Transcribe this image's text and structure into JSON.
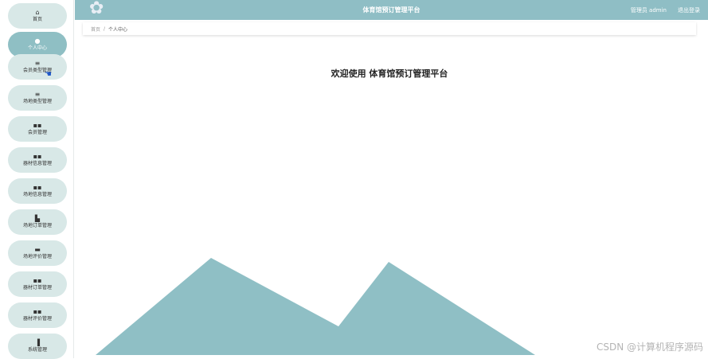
{
  "app": {
    "title": "体育馆预订管理平台"
  },
  "header": {
    "user": "管理员 admin",
    "logout": "退出登录"
  },
  "breadcrumb": {
    "home": "首页",
    "separator": "/",
    "current": "个人中心"
  },
  "welcome": "欢迎使用 体育馆预订管理平台",
  "sidebar": {
    "items": [
      {
        "icon": "⌂",
        "icon_name": "home-icon",
        "label": "首页"
      },
      {
        "icon": "●",
        "icon_name": "user-icon",
        "label": "个人中心",
        "active": true
      },
      {
        "icon": "≡",
        "icon_name": "list-icon",
        "label": "会员类型管理"
      },
      {
        "icon": "≡",
        "icon_name": "list-icon",
        "label": "场地类型管理"
      },
      {
        "icon": "▪▪",
        "icon_name": "grid-icon",
        "label": "会员管理"
      },
      {
        "icon": "▪▪",
        "icon_name": "grid-icon",
        "label": "器材信息管理"
      },
      {
        "icon": "▪▪",
        "icon_name": "grid-icon",
        "label": "场地信息管理"
      },
      {
        "icon": "▙",
        "icon_name": "table-icon",
        "label": "场地订单管理"
      },
      {
        "icon": "▬",
        "icon_name": "monitor-icon",
        "label": "场地评价管理"
      },
      {
        "icon": "▪▪",
        "icon_name": "grid-icon",
        "label": "器材订单管理"
      },
      {
        "icon": "▪▪",
        "icon_name": "grid-icon",
        "label": "器材评价管理"
      },
      {
        "icon": "▐",
        "icon_name": "chart-icon",
        "label": "系统管理"
      }
    ]
  },
  "watermark": "CSDN @计算机程序源码",
  "colors": {
    "accent": "#8fbec5",
    "nav_bg": "#d8e8e7",
    "mountain": "#8fbfc5"
  }
}
